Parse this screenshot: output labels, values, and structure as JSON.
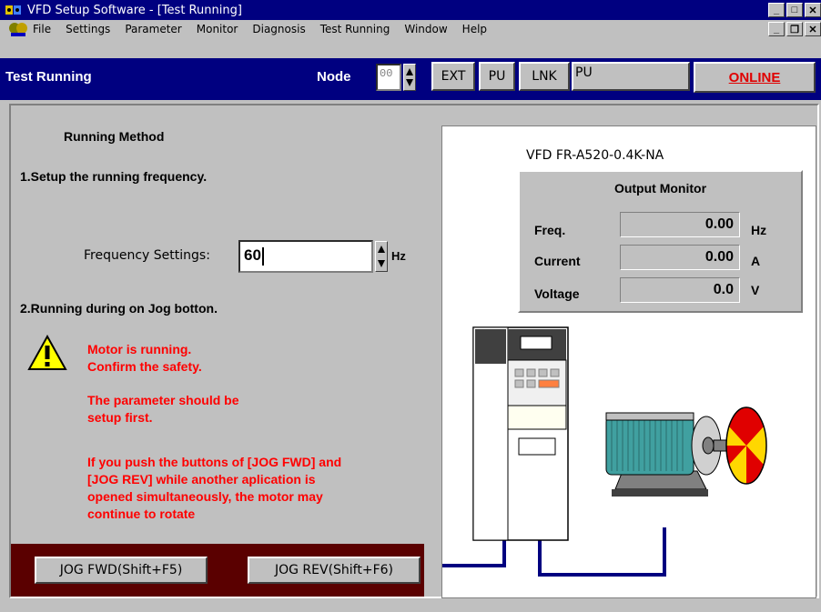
{
  "window": {
    "title": "VFD Setup Software - [Test Running]"
  },
  "menu": {
    "items": [
      {
        "label": "File",
        "key": "F"
      },
      {
        "label": "Settings",
        "key": "S"
      },
      {
        "label": "Parameter",
        "key": "P"
      },
      {
        "label": "Monitor",
        "key": "M"
      },
      {
        "label": "Diagnosis",
        "key": "g"
      },
      {
        "label": "Test Running",
        "key": "T"
      },
      {
        "label": "Window",
        "key": "W"
      },
      {
        "label": "Help",
        "key": "H"
      }
    ]
  },
  "header": {
    "title": "Test Running",
    "node_label": "Node",
    "node_value": "00",
    "ext_label": "EXT",
    "pu_label": "PU",
    "lnk_label": "LNK",
    "mode_value": "PU",
    "online_label": "ONLINE"
  },
  "left": {
    "heading": "Running Method",
    "step1": "1.Setup the running frequency.",
    "freq_label": "Frequency Settings:",
    "freq_value": "60",
    "freq_unit": "Hz",
    "step2": "2.Running during on Jog botton.",
    "warning1_line1": "Motor is running.",
    "warning1_line2": "Confirm the safety.",
    "warning2_line1": "The parameter should be",
    "warning2_line2": "setup first.",
    "warning3_line1": "If you push the buttons of [JOG FWD] and",
    "warning3_line2": "[JOG REV] while another aplication is",
    "warning3_line3": "opened simultaneously, the motor may",
    "warning3_line4": "continue to rotate",
    "jog_fwd": "JOG FWD(Shift+F5)",
    "jog_rev": "JOG REV(Shift+F6)"
  },
  "monitor": {
    "model": "VFD  FR-A520-0.4K-NA",
    "title": "Output Monitor",
    "rows": [
      {
        "label": "Freq.",
        "value": "0.00",
        "unit": "Hz"
      },
      {
        "label": "Current",
        "value": "0.00",
        "unit": "A"
      },
      {
        "label": "Voltage",
        "value": "0.0",
        "unit": "V"
      }
    ]
  },
  "colors": {
    "titlebar": "#000080",
    "warning_text": "#ff0000",
    "online_text": "#e00000",
    "jog_bar": "#5a0000"
  }
}
